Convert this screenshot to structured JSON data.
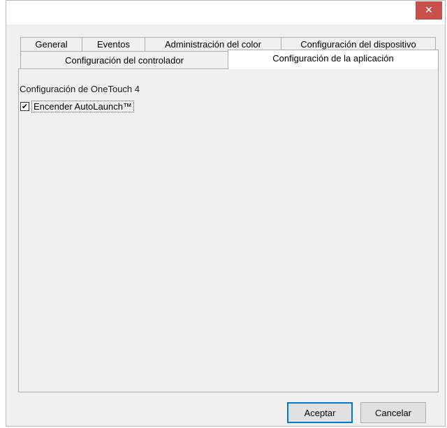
{
  "titlebar": {
    "close_label": "✕"
  },
  "tabs": {
    "row_top": [
      {
        "label": "General"
      },
      {
        "label": "Eventos"
      },
      {
        "label": "Administración del color"
      },
      {
        "label": "Configuración del dispositivo"
      }
    ],
    "row_bottom": [
      {
        "label": "Configuración del controlador"
      },
      {
        "label": "Configuración de la aplicación",
        "active": true
      }
    ]
  },
  "panel": {
    "section_title": "Configuración de OneTouch 4",
    "autolaunch": {
      "label": "Encender AutoLaunch™",
      "checked": true,
      "check_glyph": "✔"
    }
  },
  "buttons": {
    "accept": "Aceptar",
    "cancel": "Cancelar"
  },
  "colors": {
    "close_bg": "#c7504d",
    "default_button_border": "#0078d7"
  }
}
